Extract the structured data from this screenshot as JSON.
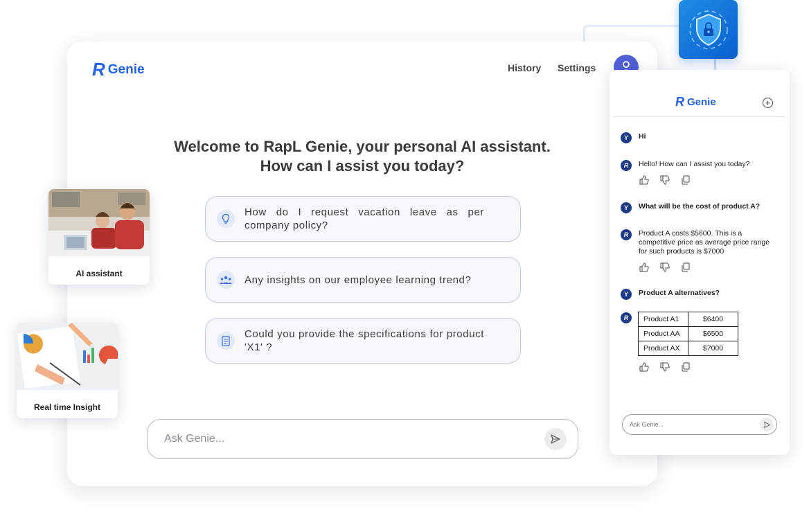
{
  "brand": {
    "mark": "R",
    "name": "Genie"
  },
  "nav": {
    "history": "History",
    "settings": "Settings"
  },
  "welcome": {
    "line1": "Welcome to RapL Genie, your personal AI assistant.",
    "line2": "How can I assist you today?"
  },
  "suggestions": [
    {
      "icon": "lightbulb-icon",
      "text": "How do I request vacation leave as per company policy?"
    },
    {
      "icon": "team-icon",
      "text": "Any insights on our employee learning trend?"
    },
    {
      "icon": "document-icon",
      "text": "Could you provide the specifications for product 'X1' ?"
    }
  ],
  "ask": {
    "placeholder": "Ask Genie..."
  },
  "cards": [
    {
      "label": "AI assistant",
      "icon": "classroom-photo"
    },
    {
      "label": "Real time Insight",
      "icon": "analytics-photo"
    }
  ],
  "security_badge": {
    "icon": "shield-lock-icon"
  },
  "chat": {
    "user_initial": "Y",
    "bot_initial": "R",
    "messages": [
      {
        "from": "user",
        "text": "Hi"
      },
      {
        "from": "bot",
        "text": "Hello! How can I assist you today?"
      },
      {
        "from": "user",
        "text": "What will be the cost of product A?"
      },
      {
        "from": "bot",
        "text": "Product A costs $5600. This is a competitive price as average price range for such products is $7000"
      },
      {
        "from": "user",
        "text": "Product A alternatives?"
      }
    ],
    "table": [
      {
        "product": "Product A1",
        "price": "$6400"
      },
      {
        "product": "Product AA",
        "price": "$6500"
      },
      {
        "product": "Product AX",
        "price": "$7000"
      }
    ],
    "placeholder": "Ask Genie..."
  },
  "colors": {
    "brand_blue": "#2563eb",
    "chat_icon_navy": "#1e3a8a",
    "avatar_bg": "#4f5fd6"
  }
}
